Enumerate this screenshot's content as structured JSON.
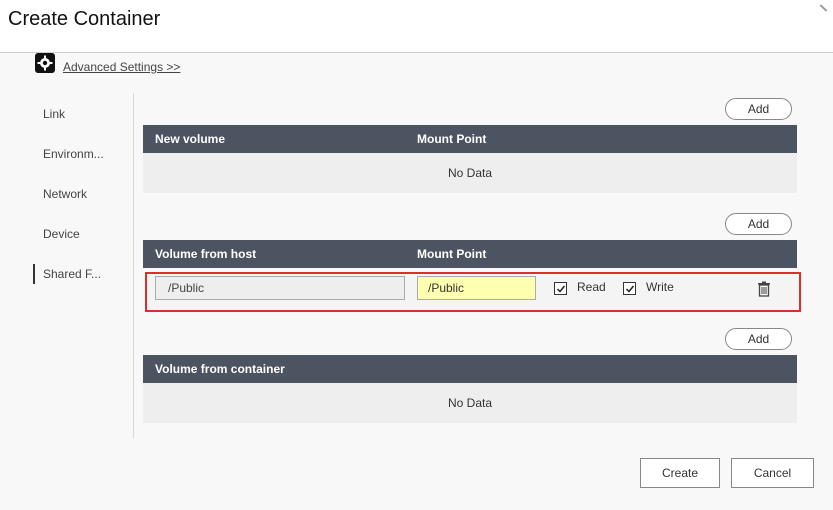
{
  "dialog": {
    "title": "Create Container"
  },
  "advanced": {
    "link": "Advanced Settings >>"
  },
  "sidebar": {
    "items": [
      {
        "label": "Link"
      },
      {
        "label": "Environm..."
      },
      {
        "label": "Network"
      },
      {
        "label": "Device"
      },
      {
        "label": "Shared F..."
      }
    ],
    "active_index": 4
  },
  "sections": {
    "new_volume": {
      "add_label": "Add",
      "columns": [
        "New volume",
        "Mount Point"
      ],
      "empty_text": "No Data"
    },
    "host_volume": {
      "add_label": "Add",
      "columns": [
        "Volume from host",
        "Mount Point"
      ],
      "rows": [
        {
          "host_path": "/Public",
          "mount_point": "/Public",
          "read_label": "Read",
          "read": true,
          "write_label": "Write",
          "write": true
        }
      ]
    },
    "container_volume": {
      "add_label": "Add",
      "columns": [
        "Volume from container"
      ],
      "empty_text": "No Data"
    }
  },
  "footer": {
    "create_label": "Create",
    "cancel_label": "Cancel"
  },
  "colors": {
    "header_bg": "#4d5461",
    "highlight_border": "#d9302c",
    "mount_input_bg": "#ffffb0"
  }
}
